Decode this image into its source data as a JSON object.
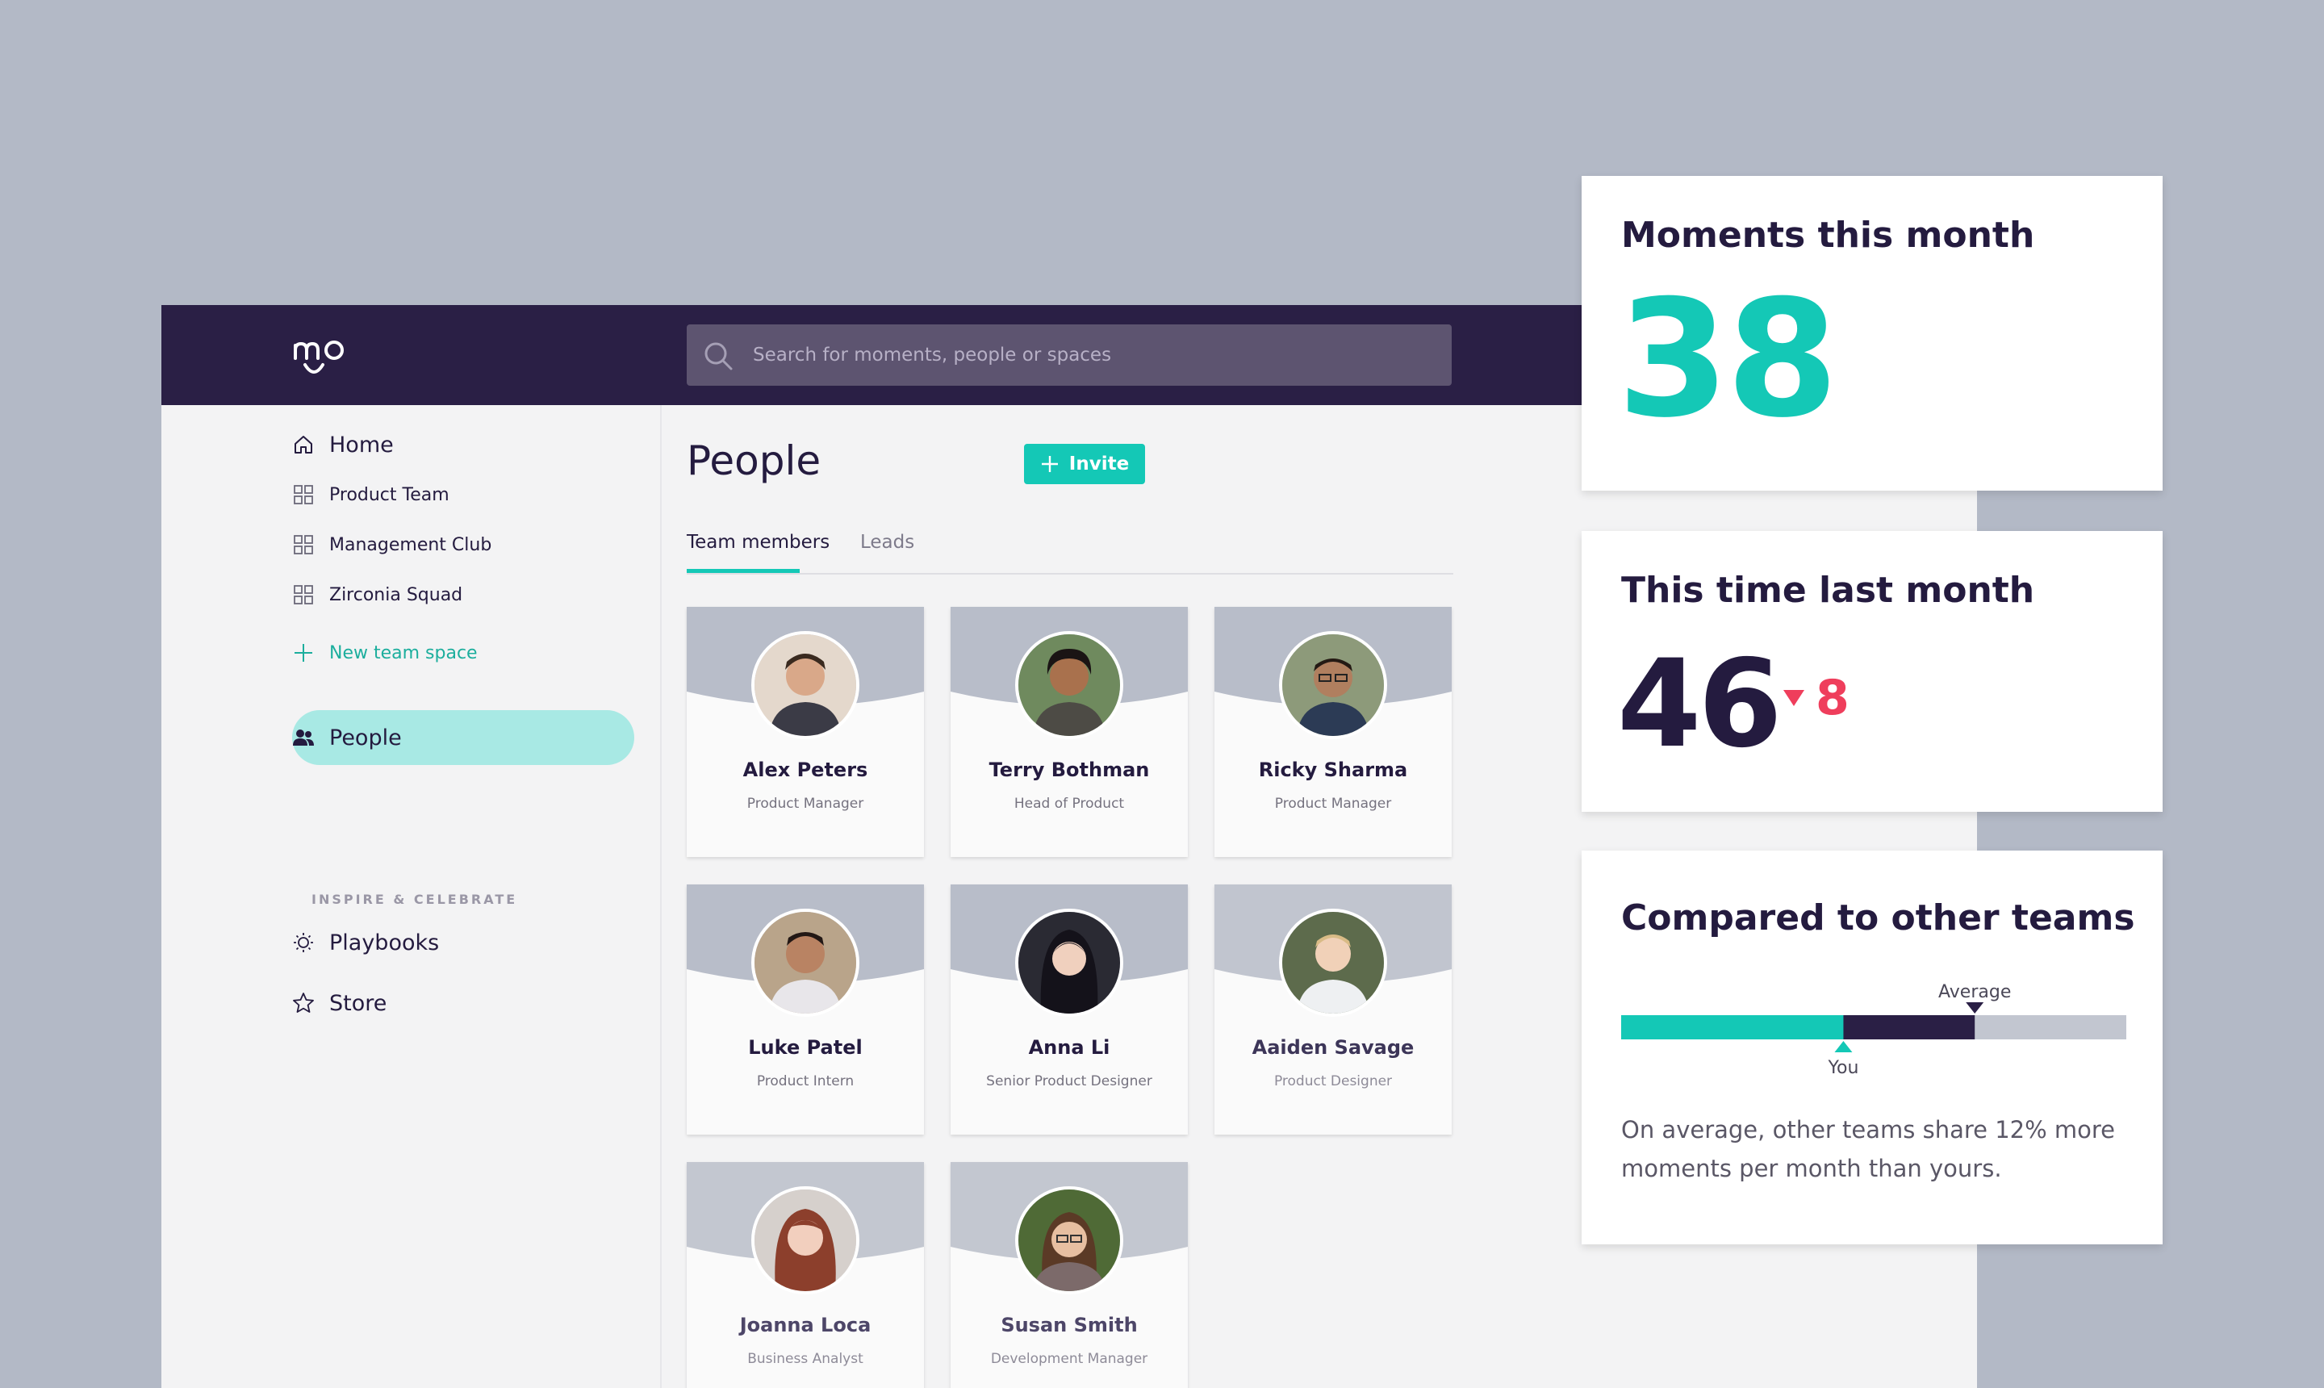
{
  "app": {
    "logo": "mo",
    "search": {
      "placeholder": "Search for moments, people or spaces"
    }
  },
  "sidebar": {
    "items": [
      {
        "label": "Home",
        "icon": "home-icon"
      },
      {
        "label": "Product Team",
        "icon": "grid-icon"
      },
      {
        "label": "Management Club",
        "icon": "grid-icon"
      },
      {
        "label": "Zirconia Squad",
        "icon": "grid-icon"
      },
      {
        "label": "New team space",
        "icon": "plus-icon"
      },
      {
        "label": "People",
        "icon": "people-icon",
        "active": true
      }
    ],
    "section_label": "INSPIRE & CELEBRATE",
    "inspire_items": [
      {
        "label": "Playbooks",
        "icon": "bulb-icon"
      },
      {
        "label": "Store",
        "icon": "star-icon"
      }
    ]
  },
  "main": {
    "title": "People",
    "invite_label": "Invite",
    "tabs": [
      {
        "label": "Team members",
        "active": true
      },
      {
        "label": "Leads",
        "active": false
      }
    ],
    "members": [
      {
        "name": "Alex Peters",
        "role": "Product Manager"
      },
      {
        "name": "Terry Bothman",
        "role": "Head of Product"
      },
      {
        "name": "Ricky Sharma",
        "role": "Product Manager"
      },
      {
        "name": "Luke Patel",
        "role": "Product Intern"
      },
      {
        "name": "Anna Li",
        "role": "Senior Product Designer"
      },
      {
        "name": "Aaiden Savage",
        "role": "Product Designer"
      },
      {
        "name": "Joanna Loca",
        "role": "Business Analyst"
      },
      {
        "name": "Susan Smith",
        "role": "Development Manager"
      }
    ]
  },
  "stats": {
    "moments": {
      "title": "Moments this month",
      "value": "38"
    },
    "last_month": {
      "title": "This time last month",
      "value": "46",
      "delta": "8",
      "delta_direction": "down"
    },
    "compare": {
      "title": "Compared to other teams",
      "average_label": "Average",
      "you_label": "You",
      "you_fraction": 0.44,
      "average_fraction": 0.7,
      "text": "On average, other teams share 12% more moments per month than yours."
    }
  },
  "colors": {
    "accent": "#14c8b6",
    "dark": "#2a1f45",
    "negative": "#ef3e5c",
    "background": "#b3b9c6"
  }
}
